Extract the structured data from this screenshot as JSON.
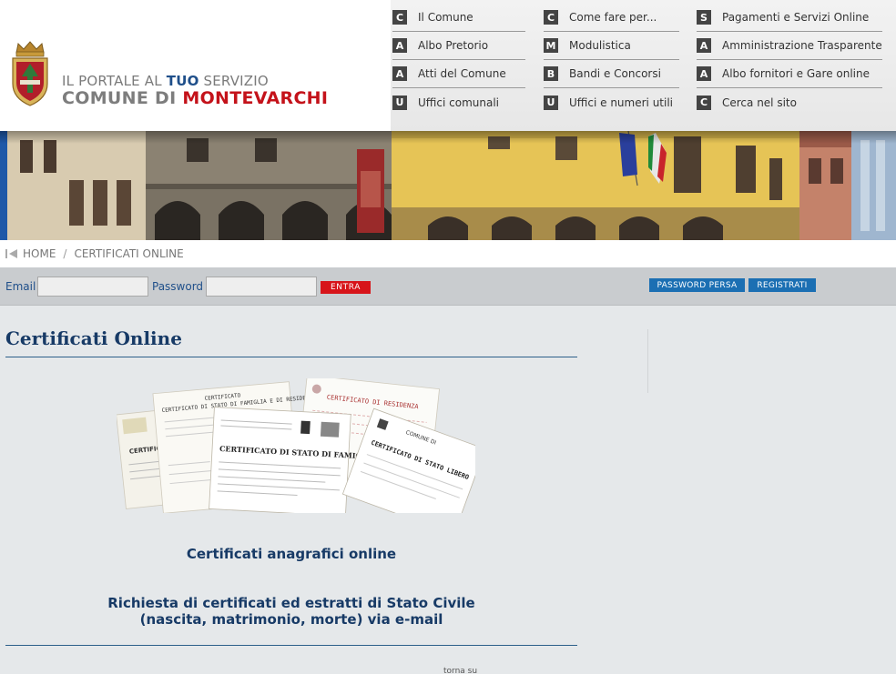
{
  "header": {
    "tagline_pre": "IL PORTALE AL ",
    "tagline_accent": "TUO",
    "tagline_post": " SERVIZIO",
    "city_pre": "COMUNE DI ",
    "city_red": "MONTEVARCHI",
    "crest_icon": "city-crest-icon"
  },
  "nav": {
    "columns": [
      [
        {
          "letter": "C",
          "label": "Il Comune"
        },
        {
          "letter": "A",
          "label": "Albo Pretorio"
        },
        {
          "letter": "A",
          "label": "Atti del Comune"
        },
        {
          "letter": "U",
          "label": "Uffici comunali"
        }
      ],
      [
        {
          "letter": "C",
          "label": "Come fare per..."
        },
        {
          "letter": "M",
          "label": "Modulistica"
        },
        {
          "letter": "B",
          "label": "Bandi e Concorsi"
        },
        {
          "letter": "U",
          "label": "Uffici e numeri utili"
        }
      ],
      [
        {
          "letter": "S",
          "label": "Pagamenti e Servizi Online"
        },
        {
          "letter": "A",
          "label": "Amministrazione Trasparente"
        },
        {
          "letter": "A",
          "label": "Albo fornitori e Gare online"
        },
        {
          "letter": "C",
          "label": "Cerca nel sito"
        }
      ]
    ]
  },
  "breadcrumb": {
    "home": "HOME",
    "separator": "/",
    "current": "CERTIFICATI ONLINE"
  },
  "login": {
    "email_label": "Email",
    "email_value": "",
    "password_label": "Password",
    "password_value": "",
    "enter_button": "ENTRA",
    "lost_password_button": "PASSWORD PERSA",
    "register_button": "REGISTRATI"
  },
  "content": {
    "title": "Certificati Online",
    "link_registry": "Certificati anagrafici online",
    "link_civil_line1": "Richiesta di certificati ed estratti di Stato Civile",
    "link_civil_line2": "(nascita, matrimonio, morte) via e-mail",
    "footer_link": "torna su",
    "image_texts": {
      "cert_family_residence": "CERTIFICATO DI STATO DI FAMIGLIA E DI RESIDENZA",
      "cert_residence": "CERTIFICATO DI RESIDENZA",
      "cert_family": "CERTIFICATO DI STATO DI FAMIGLIA",
      "cert_free": "CERTIFICATO DI STATO LIBERO",
      "comune": "COMUNE DI"
    }
  },
  "colors": {
    "brand_blue": "#173a66",
    "accent_red": "#c4121a",
    "button_red": "#d7141a",
    "button_blue": "#1b6fb3"
  }
}
